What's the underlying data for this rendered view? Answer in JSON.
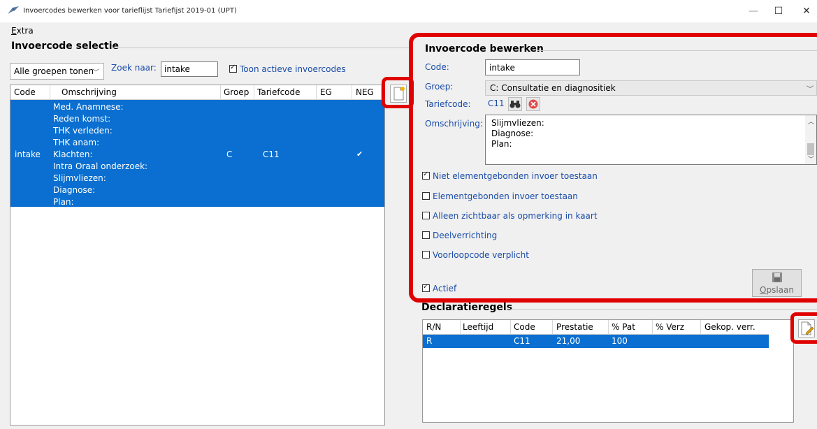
{
  "window": {
    "title": "Invoercodes bewerken voor tarieflijst Tariefijst 2019-01 (UPT)",
    "minimize": "—",
    "maximize": "☐",
    "close": "✕"
  },
  "menu": {
    "extra_first": "E",
    "extra_rest": "xtra"
  },
  "selection": {
    "title": "Invoercode selectie",
    "group_filter": "Alle groepen tonen",
    "search_label": "Zoek naar:",
    "search_value": "intake",
    "active_only_label": "Toon actieve invoercodes",
    "active_only_checked": true,
    "columns": [
      "Code",
      "Omschrijving",
      "Groep",
      "Tariefcode",
      "EG",
      "NEG"
    ],
    "rows": [
      {
        "code": "intake",
        "description_lines": [
          "Med. Anamnese:",
          "Reden komst:",
          "THK verleden:",
          "THK anam:",
          "Klachten:",
          "Intra Oraal onderzoek:",
          "Slijmvliezen:",
          "Diagnose:",
          "Plan:"
        ],
        "groep": "C",
        "tariefcode": "C11",
        "eg": "",
        "neg": "✔"
      }
    ]
  },
  "edit": {
    "title": "Invoercode bewerken",
    "code_label": "Code:",
    "code_value": "intake",
    "groep_label": "Groep:",
    "groep_value": "C: Consultatie en diagnositiek",
    "tariefcode_label": "Tariefcode:",
    "tariefcode_value": "C11",
    "omschrijving_label": "Omschrijving:",
    "omschrijving_lines": [
      "Slijmvliezen:",
      "Diagnose:",
      "Plan:"
    ],
    "options": [
      {
        "label": "Niet elementgebonden invoer toestaan",
        "checked": true
      },
      {
        "label": "Elementgebonden invoer toestaan",
        "checked": false
      },
      {
        "label": "Alleen zichtbaar als opmerking in kaart",
        "checked": false
      },
      {
        "label": "Deelverrichting",
        "checked": false
      },
      {
        "label": "Voorloopcode verplicht",
        "checked": false
      }
    ],
    "actief_label": "Actief",
    "actief_checked": true,
    "save_first": "O",
    "save_rest": "pslaan"
  },
  "declaratie": {
    "title": "Declaratieregels",
    "columns": [
      "R/N",
      "Leeftijd",
      "Code",
      "Prestatie",
      "% Pat",
      "% Verz",
      "Gekop. verr."
    ],
    "rows": [
      {
        "rn": "R",
        "leeftijd": "",
        "code": "C11",
        "prestatie": "21,00",
        "pat": "100",
        "verz": "",
        "gekop": ""
      }
    ]
  },
  "colors": {
    "selection_blue": "#0a6fd0",
    "label_blue": "#1a4ca8",
    "highlight_red": "#e00000"
  }
}
